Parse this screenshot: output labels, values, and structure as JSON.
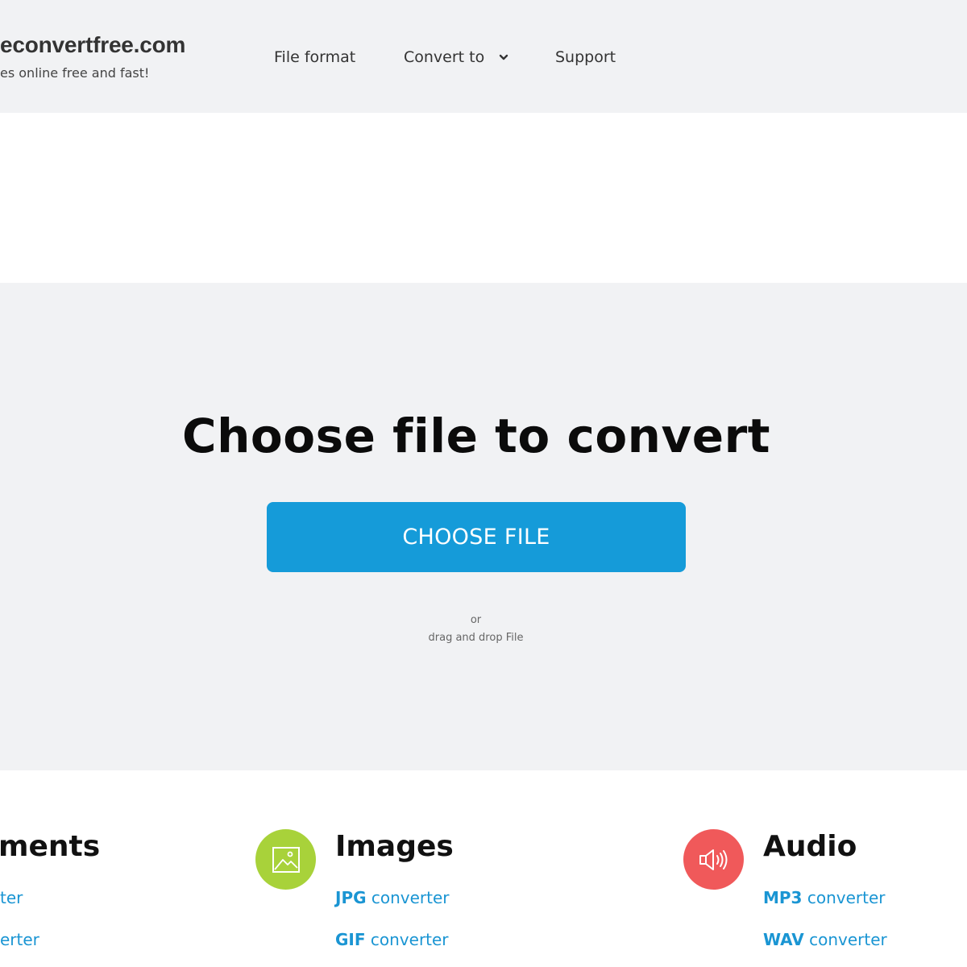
{
  "header": {
    "logo_title": "...convertfree.com",
    "logo_title_visible": "econvertfree.com",
    "logo_tagline": "es online free and fast!",
    "nav": {
      "file_format": "File format",
      "convert_to": "Convert to",
      "support": "Support"
    }
  },
  "hero": {
    "title": "Choose file to convert",
    "button_label": "CHOOSE FILE",
    "or_text": "or",
    "drag_drop_text": "drag and drop File"
  },
  "categories": {
    "documents": {
      "title": "ments",
      "links": [
        {
          "prefix": "",
          "suffix": "ter"
        },
        {
          "prefix": "",
          "suffix": "erter"
        }
      ]
    },
    "images": {
      "title": "Images",
      "icon": "image-icon",
      "icon_color": "#a8d23a",
      "links": [
        {
          "prefix": "JPG",
          "suffix": " converter"
        },
        {
          "prefix": "GIF",
          "suffix": " converter"
        }
      ]
    },
    "audio": {
      "title": "Audio",
      "icon": "speaker-icon",
      "icon_color": "#f0595a",
      "links": [
        {
          "prefix": "MP3",
          "suffix": " converter"
        },
        {
          "prefix": "WAV",
          "suffix": " converter"
        }
      ]
    }
  },
  "colors": {
    "accent": "#159bd9",
    "link": "#1a95d3",
    "band_bg": "#f1f2f4"
  }
}
